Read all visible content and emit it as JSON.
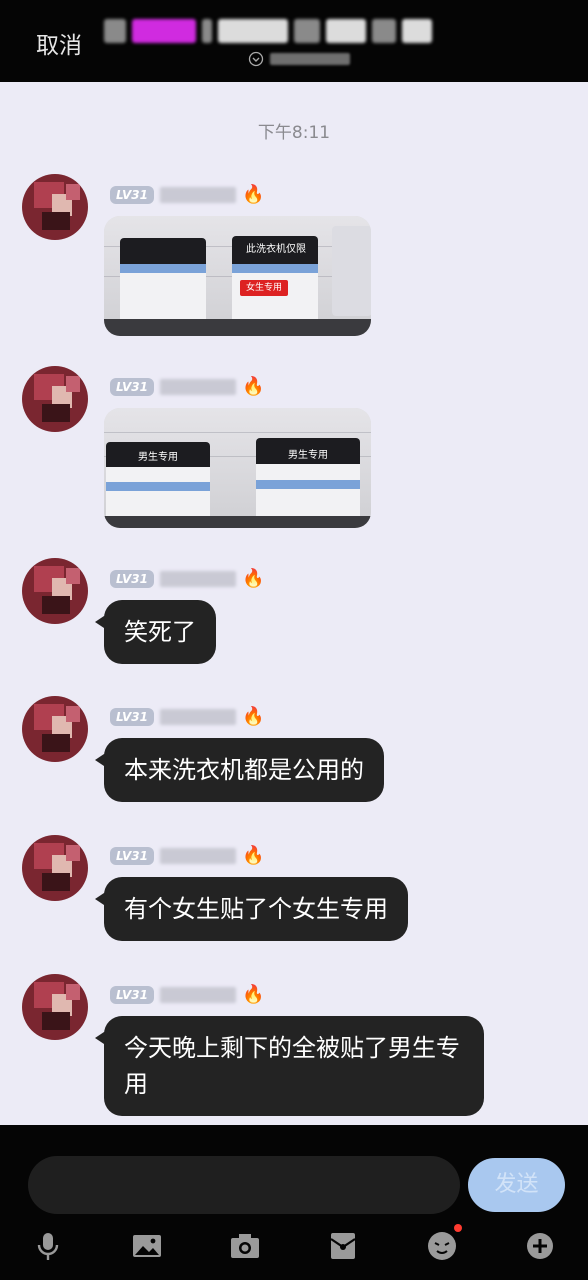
{
  "header": {
    "cancel_label": "取消"
  },
  "chat": {
    "timestamp": "下午8:11",
    "level_badge": "LV31",
    "messages": [
      {
        "type": "image"
      },
      {
        "type": "image"
      },
      {
        "type": "text",
        "text": "笑死了"
      },
      {
        "type": "text",
        "text": "本来洗衣机都是公用的"
      },
      {
        "type": "text",
        "text": "有个女生贴了个女生专用"
      },
      {
        "type": "text",
        "text": "今天晚上剩下的全被贴了男生专用"
      }
    ],
    "image1": {
      "label_right": "女生专用",
      "sign_right": "此洗衣机仅限"
    },
    "image2": {
      "label_left": "男生专用",
      "label_right": "男生专用"
    }
  },
  "composer": {
    "send_label": "发送"
  },
  "toolbar": {
    "icons": [
      "microphone-icon",
      "image-icon",
      "camera-icon",
      "red-packet-icon",
      "emoji-icon",
      "plus-icon"
    ]
  },
  "colors": {
    "chat_bg": "#ecebf6",
    "bubble_bg": "#232323",
    "send_bg": "#a9c8ef",
    "notify_dot": "#ff3b30"
  }
}
